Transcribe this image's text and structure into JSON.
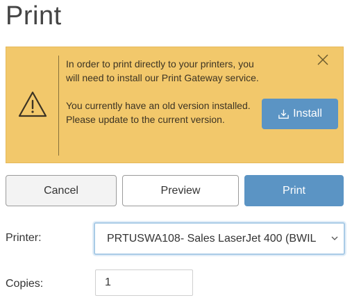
{
  "page": {
    "title": "Print"
  },
  "alert": {
    "message_line1": "In order to print directly to your printers, you will need to install our Print Gateway service.",
    "message_line2": "You currently have an old version installed. Please update to the current version.",
    "install_label": "Install",
    "icons": {
      "warning": "warning-triangle-icon",
      "close": "close-icon",
      "install": "download-tray-icon"
    },
    "colors": {
      "background": "#f2c86b",
      "button": "#5b94c4"
    }
  },
  "actions": {
    "cancel_label": "Cancel",
    "preview_label": "Preview",
    "print_label": "Print"
  },
  "form": {
    "printer_label": "Printer:",
    "printer_value": "PRTUSWA108- Sales LaserJet 400 (BWIL",
    "copies_label": "Copies:",
    "copies_value": "1"
  }
}
